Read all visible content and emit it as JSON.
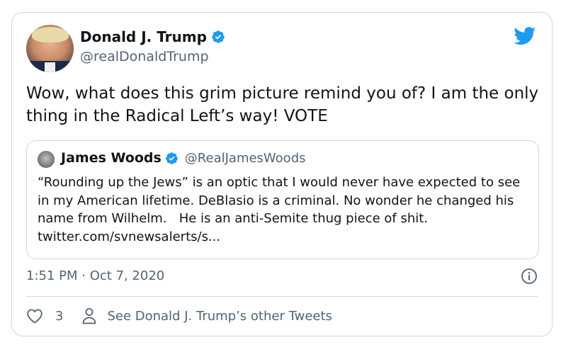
{
  "tweet": {
    "author_name": "Donald J. Trump",
    "author_handle": "@realDonaldTrump",
    "text": "Wow, what does this grim picture remind you of? I am the only thing in the Radical Left’s way! VOTE",
    "timestamp": "1:51 PM · Oct 7, 2020",
    "like_count": "3",
    "other_tweets_label": "See Donald J. Trump’s other Tweets"
  },
  "quoted_tweet": {
    "author_name": "James Woods",
    "author_handle": "@RealJamesWoods",
    "text": "“Rounding up the Jews” is an optic that I would never have expected to see in my American lifetime. DeBlasio is a criminal. No wonder he changed his name from Wilhelm.   He is an anti-Semite thug piece of shit. twitter.com/svnewsalerts/s..."
  },
  "icons": {
    "verified": "verified-badge-icon",
    "brand": "twitter-bird-icon",
    "info": "info-icon",
    "like": "heart-icon",
    "profile": "person-icon"
  },
  "colors": {
    "brand_blue": "#1d9bf0",
    "text_primary": "#0f1419",
    "text_secondary": "#536471",
    "border": "#cfd9de"
  }
}
